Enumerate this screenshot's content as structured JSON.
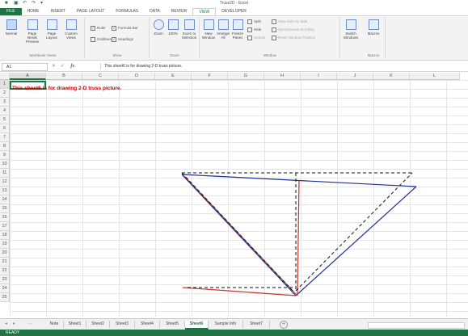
{
  "window": {
    "title": "Truss2D - Excel"
  },
  "ribbon_tabs": [
    {
      "label": "FILE"
    },
    {
      "label": "HOME"
    },
    {
      "label": "INSERT"
    },
    {
      "label": "PAGE LAYOUT"
    },
    {
      "label": "FORMULAS"
    },
    {
      "label": "DATA"
    },
    {
      "label": "REVIEW"
    },
    {
      "label": "VIEW"
    },
    {
      "label": "DEVELOPER"
    }
  ],
  "ribbon": {
    "workbook_views": {
      "label": "Workbook Views",
      "buttons": [
        "Normal",
        "Page Break Preview",
        "Page Layout",
        "Custom Views"
      ]
    },
    "show": {
      "label": "Show",
      "ruler": "Ruler",
      "gridlines": "Gridlines",
      "formula_bar": "Formula Bar",
      "headings": "Headings"
    },
    "zoom": {
      "label": "Zoom",
      "buttons": [
        "Zoom",
        "100%",
        "Zoom to Selection"
      ]
    },
    "window": {
      "label": "Window",
      "buttons": [
        "New Window",
        "Arrange All",
        "Freeze Panes"
      ],
      "split": "Split",
      "hide": "Hide",
      "unhide": "Unhide",
      "side_by_side": "View Side by Side",
      "sync_scroll": "Synchronous Scrolling",
      "reset_pos": "Reset Window Position",
      "switch": "Switch Windows"
    },
    "macros": {
      "label": "Macros",
      "button": "Macros"
    }
  },
  "formula_bar": {
    "name_box": "A1",
    "fx": "fx",
    "content": "This sheet6 is for drawing 2-D truss picture."
  },
  "columns": [
    "A",
    "B",
    "C",
    "D",
    "E",
    "F",
    "G",
    "H",
    "I",
    "J",
    "K",
    "L"
  ],
  "rows": [
    "1",
    "2",
    "3",
    "4",
    "5",
    "6",
    "7",
    "8",
    "9",
    "10",
    "11",
    "12",
    "13",
    "14",
    "15",
    "16",
    "17",
    "18",
    "19",
    "20",
    "21",
    "22",
    "23",
    "24",
    "25"
  ],
  "cell_a1": "This sheet6 is for drawing 2-D truss picture.",
  "sheet_tabs": [
    {
      "label": "Note",
      "active": false
    },
    {
      "label": "Sheet1",
      "active": false
    },
    {
      "label": "Sheet2",
      "active": false
    },
    {
      "label": "Sheet3",
      "active": false
    },
    {
      "label": "Sheet4",
      "active": false
    },
    {
      "label": "Sheet5",
      "active": false
    },
    {
      "label": "Sheet6",
      "active": true
    },
    {
      "label": "Sample Info",
      "active": false
    },
    {
      "label": "Sheet7",
      "active": false
    }
  ],
  "status": {
    "text": "READY"
  },
  "colors": {
    "excel_green": "#217346",
    "a1_text": "#c00000",
    "truss_blue": "#1f2f8f",
    "truss_red": "#c0392b"
  }
}
